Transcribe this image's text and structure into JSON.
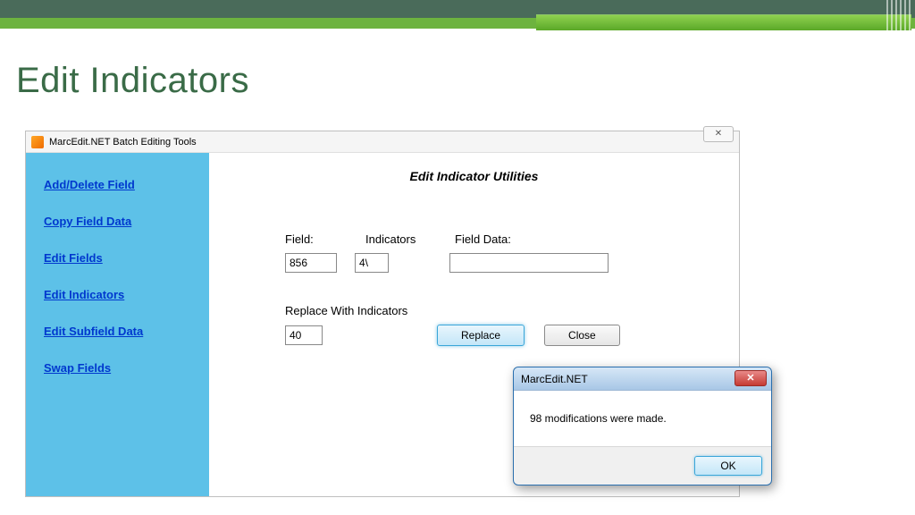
{
  "slide": {
    "title": "Edit Indicators"
  },
  "window": {
    "title": "MarcEdit.NET Batch Editing Tools",
    "close_glyph": "✕"
  },
  "sidebar": {
    "items": [
      {
        "label": "Add/Delete Field"
      },
      {
        "label": "Copy Field Data"
      },
      {
        "label": "Edit Fields"
      },
      {
        "label": "Edit Indicators"
      },
      {
        "label": "Edit Subfield Data"
      },
      {
        "label": "Swap Fields"
      }
    ]
  },
  "panel": {
    "title": "Edit Indicator Utilities",
    "labels": {
      "field": "Field:",
      "indicators": "Indicators",
      "field_data": "Field Data:",
      "replace_with": "Replace With Indicators"
    },
    "values": {
      "field": "856",
      "indicators": "4\\",
      "field_data": "",
      "replace_with": "40"
    },
    "buttons": {
      "replace": "Replace",
      "close": "Close"
    }
  },
  "msgbox": {
    "title": "MarcEdit.NET",
    "body": "98 modifications were made.",
    "ok": "OK",
    "close_glyph": "✕"
  }
}
